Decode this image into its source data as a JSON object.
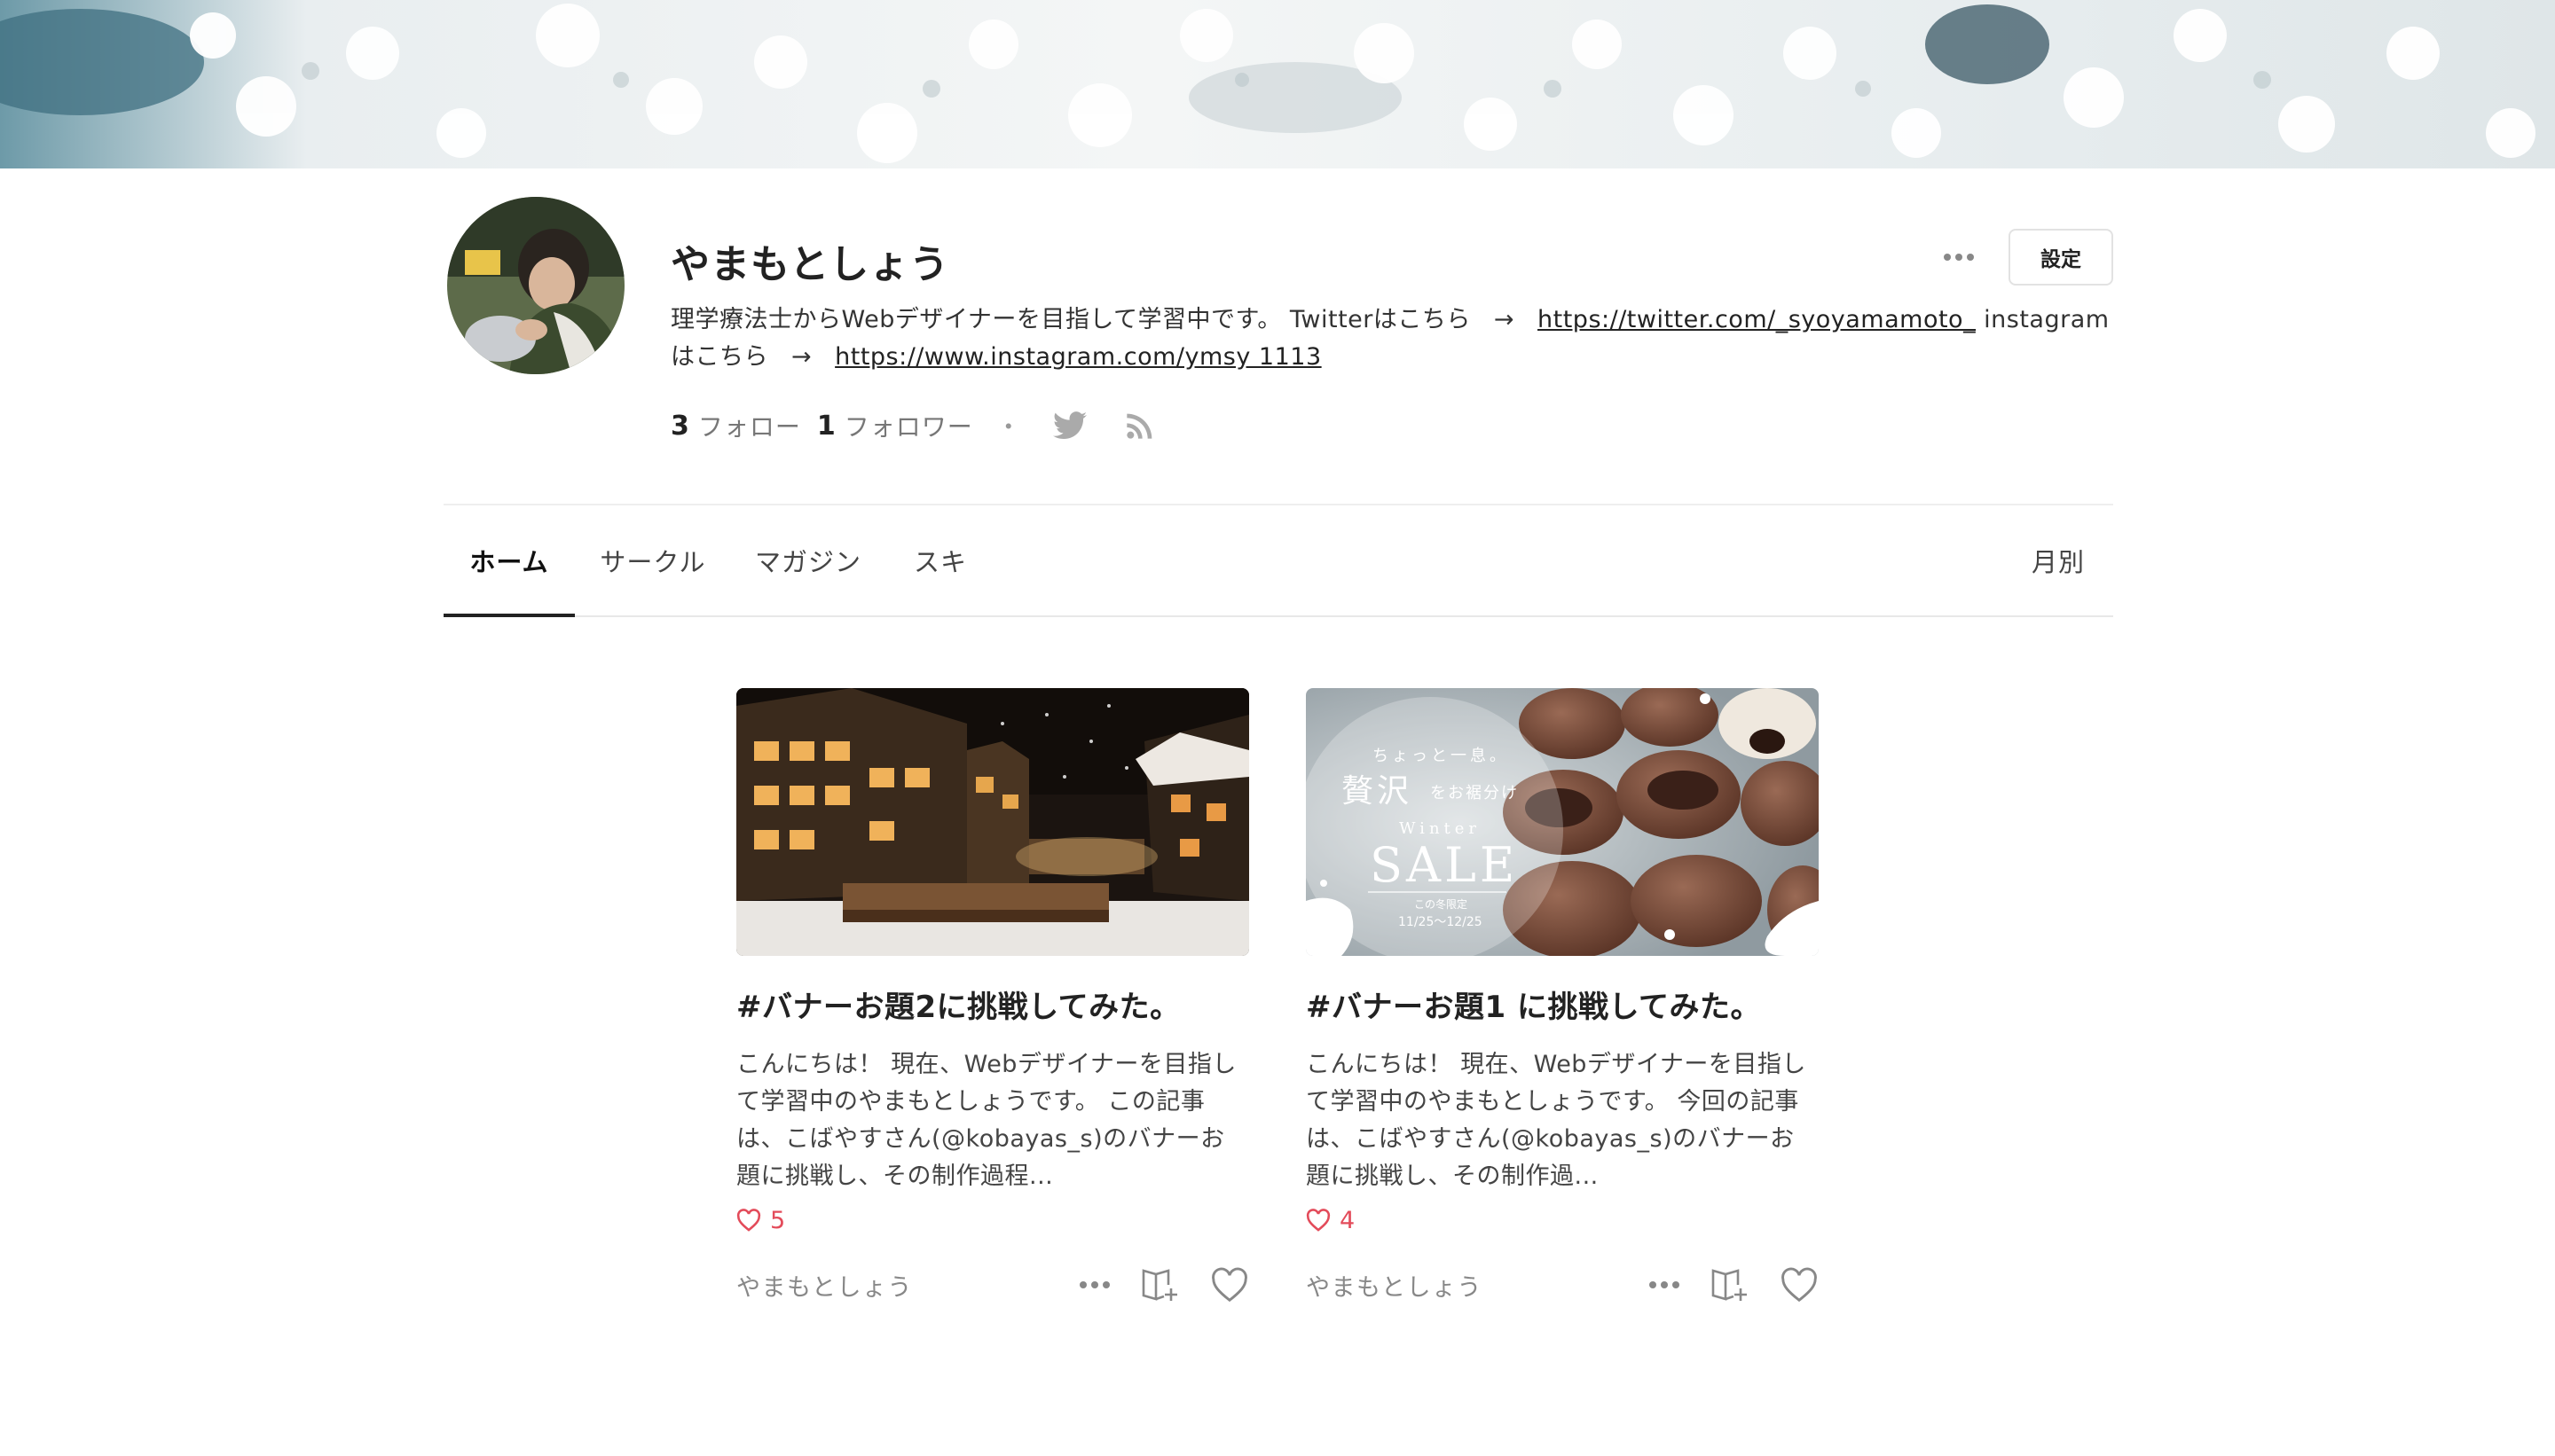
{
  "profile": {
    "name": "やまもとしょう",
    "settings_label": "設定",
    "bio": {
      "text1": "理学療法士からWebデザイナーを目指して学習中です。 Twitterはこちら",
      "arrow": "→",
      "twitter_url": "https://twitter.com/_syoyamamoto_",
      "text2": " instagramはこちら",
      "instagram_url": "https://www.instagram.com/ymsy 1113"
    },
    "stats": {
      "follow_count": "3",
      "follow_label": "フォロー",
      "follower_count": "1",
      "follower_label": "フォロワー",
      "separator": "・"
    },
    "icons": [
      "more-icon",
      "twitter-icon",
      "rss-icon"
    ]
  },
  "tabs": {
    "home": "ホーム",
    "circle": "サークル",
    "magazine": "マガジン",
    "suki": "スキ",
    "monthly": "月別"
  },
  "cards": [
    {
      "title": "#バナーお題2に挑戦してみた。",
      "excerpt": "こんにちは！ 現在、Webデザイナーを目指して学習中のやまもとしょうです。 この記事は、こばやすさん(@kobayas_s)のバナーお題に挑戦し、その制作過程...",
      "likes": "5",
      "author": "やまもとしょう"
    },
    {
      "title": "#バナーお題1 に挑戦してみた。",
      "excerpt": "こんにちは！ 現在、Webデザイナーを目指して学習中のやまもとしょうです。 今回の記事は、こばやすさん(@kobayas_s)のバナーお題に挑戦し、その制作過...",
      "likes": "4",
      "author": "やまもとしょう",
      "banner": {
        "line1": "ちょっと一息。",
        "line2_big": "贅沢",
        "line2_small": "をお裾分け",
        "winter": "Winter",
        "sale": "SALE",
        "period_label": "この冬限定",
        "period": "11/25〜12/25"
      }
    }
  ],
  "colors": {
    "like": "#e34b5a",
    "text": "#222222",
    "muted": "#888888"
  }
}
